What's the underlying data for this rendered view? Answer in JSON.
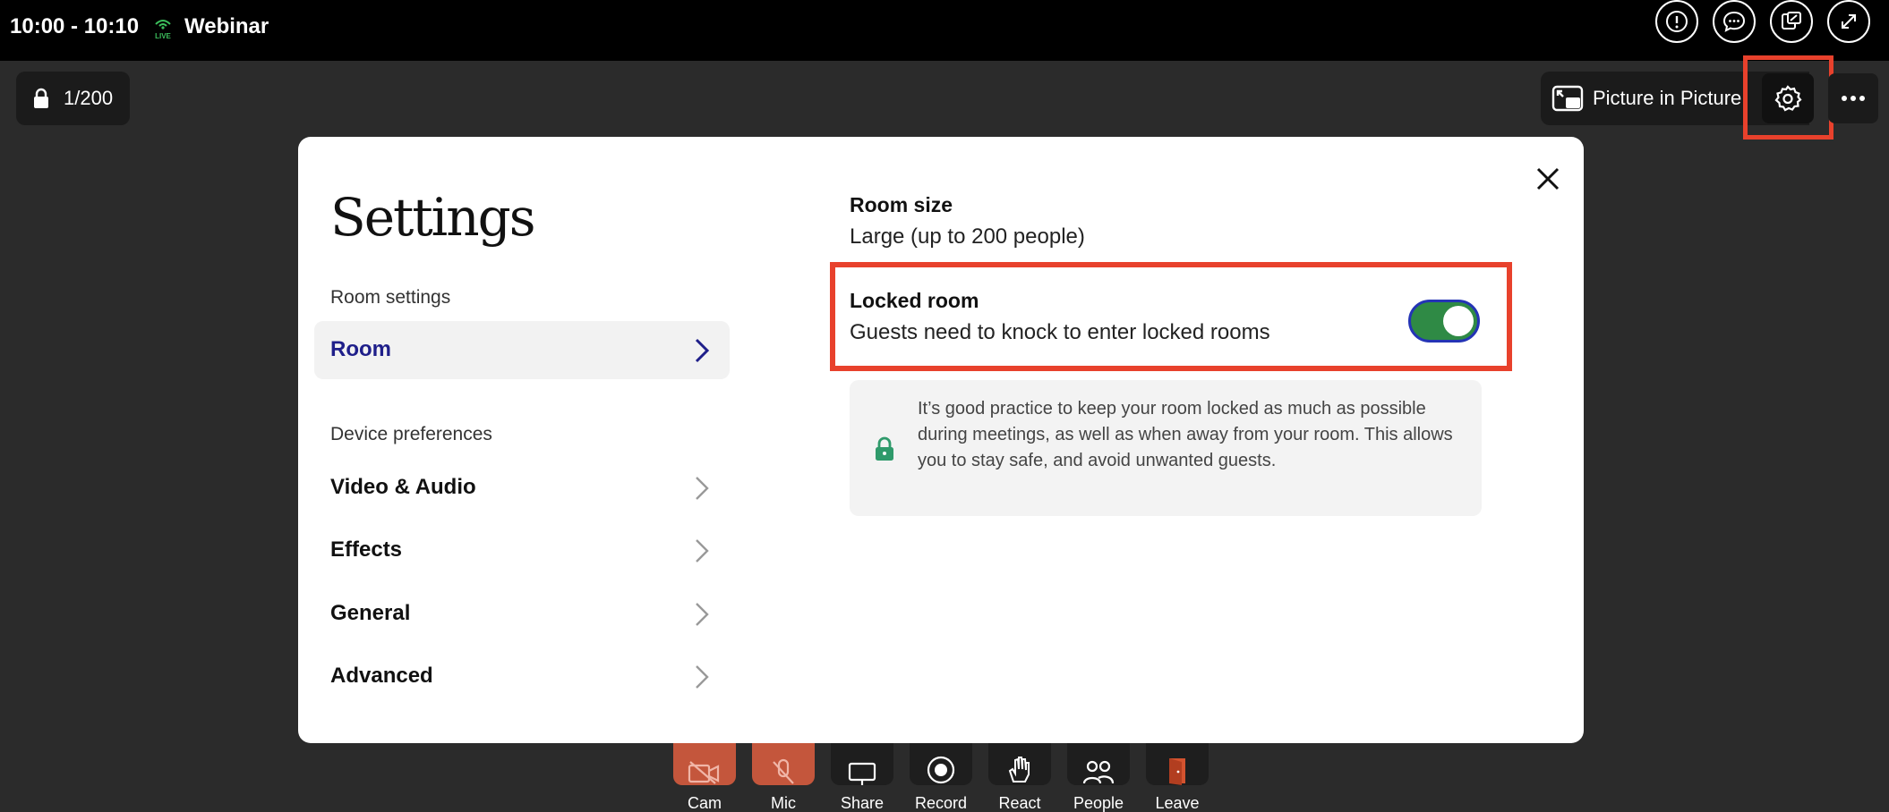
{
  "topbar": {
    "time": "10:00 - 10:10",
    "live_badge": "LIVE",
    "title": "Webinar",
    "icons": [
      "info-icon",
      "chat-icon",
      "screen-share-icon",
      "expand-icon"
    ]
  },
  "room_chip": {
    "count": "1/200"
  },
  "pip": {
    "label": "Picture in Picture"
  },
  "controls": [
    {
      "label": "Cam",
      "icon": "cam-off-icon"
    },
    {
      "label": "Mic",
      "icon": "mic-off-icon"
    },
    {
      "label": "Share",
      "icon": "share-icon"
    },
    {
      "label": "Record",
      "icon": "record-icon"
    },
    {
      "label": "React",
      "icon": "react-icon"
    },
    {
      "label": "People",
      "icon": "people-icon"
    },
    {
      "label": "Leave",
      "icon": "leave-icon"
    }
  ],
  "modal": {
    "title": "Settings",
    "room_settings_label": "Room settings",
    "device_preferences_label": "Device preferences",
    "nav": {
      "room": "Room",
      "video_audio": "Video & Audio",
      "effects": "Effects",
      "general": "General",
      "advanced": "Advanced"
    },
    "room_size": {
      "title": "Room size",
      "value": "Large (up to 200 people)"
    },
    "locked_room": {
      "title": "Locked room",
      "description": "Guests need to knock to enter locked rooms",
      "enabled": true
    },
    "info": "It’s good practice to keep your room locked as much as possible during meetings, as well as when away from your room. This allows you to stay safe, and avoid unwanted guests."
  },
  "colors": {
    "highlight": "#e8412c",
    "toggle_on": "#2f8a45",
    "active_nav": "#1f1f8a",
    "cam_mic_off": "#c4563c"
  }
}
